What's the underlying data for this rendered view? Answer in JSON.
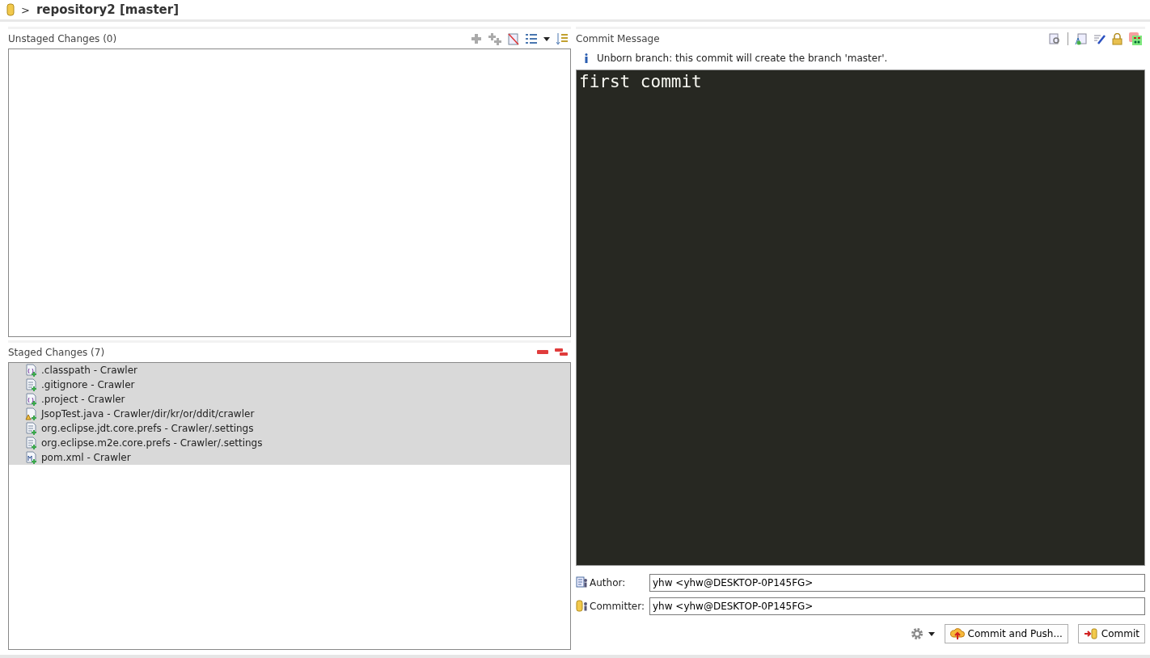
{
  "header": {
    "separator": ">",
    "title": "repository2 [master]"
  },
  "unstaged": {
    "title": "Unstaged Changes (0)"
  },
  "staged": {
    "title": "Staged Changes (7)",
    "files": [
      {
        "label": ".classpath - Crawler",
        "kind": "config",
        "selected": true
      },
      {
        "label": ".gitignore - Crawler",
        "kind": "text",
        "selected": true
      },
      {
        "label": ".project - Crawler",
        "kind": "config",
        "selected": true
      },
      {
        "label": "JsopTest.java - Crawler/dir/kr/or/ddit/crawler",
        "kind": "java",
        "selected": true
      },
      {
        "label": "org.eclipse.jdt.core.prefs - Crawler/.settings",
        "kind": "text",
        "selected": true
      },
      {
        "label": "org.eclipse.m2e.core.prefs - Crawler/.settings",
        "kind": "text",
        "selected": true
      },
      {
        "label": "pom.xml - Crawler",
        "kind": "maven",
        "selected": true
      }
    ]
  },
  "commit": {
    "title": "Commit Message",
    "info": "Unborn branch: this commit will create the branch 'master'.",
    "message": "first commit",
    "author_label": "Author:",
    "author": "yhw <yhw@DESKTOP-0P145FG>",
    "committer_label": "Committer:",
    "committer": "yhw <yhw@DESKTOP-0P145FG>",
    "buttons": [
      "Commit and Push...",
      "Commit"
    ]
  }
}
